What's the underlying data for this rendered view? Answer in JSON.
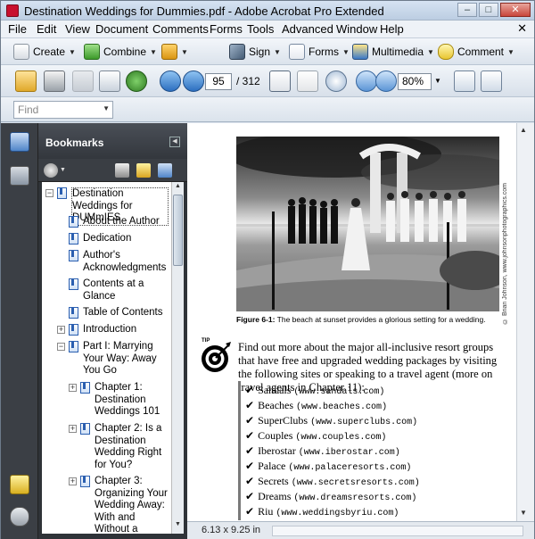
{
  "window": {
    "title": "Destination Weddings for Dummies.pdf - Adobe Acrobat Pro Extended",
    "min_label": "–",
    "max_label": "□",
    "close_label": "✕"
  },
  "menu": {
    "items": [
      "File",
      "Edit",
      "View",
      "Document",
      "Comments",
      "Forms",
      "Tools",
      "Advanced",
      "Window",
      "Help"
    ],
    "close_doc": "✕"
  },
  "toolbar1": {
    "create": "Create",
    "combine": "Combine",
    "sign": "Sign",
    "forms": "Forms",
    "multimedia": "Multimedia",
    "comment": "Comment"
  },
  "toolbar2": {
    "page_number": "95",
    "page_total": "/ 312",
    "zoom": "80%"
  },
  "find": {
    "placeholder": "Find"
  },
  "bookmarks": {
    "title": "Bookmarks",
    "items": [
      {
        "label": "Destination Weddings for DUMmIES",
        "expander": "−",
        "level": 0
      },
      {
        "label": "About the Author",
        "expander": "",
        "level": 1
      },
      {
        "label": "Dedication",
        "expander": "",
        "level": 1
      },
      {
        "label": "Author's Acknowledgments",
        "expander": "",
        "level": 1
      },
      {
        "label": "Contents at a Glance",
        "expander": "",
        "level": 1
      },
      {
        "label": "Table of Contents",
        "expander": "",
        "level": 1
      },
      {
        "label": "Introduction",
        "expander": "+",
        "level": 1
      },
      {
        "label": "Part I: Marrying Your Way: Away You Go",
        "expander": "−",
        "level": 1
      },
      {
        "label": "Chapter 1: Destination Weddings 101",
        "expander": "+",
        "level": 2
      },
      {
        "label": "Chapter 2: Is a Destination Wedding Right for You?",
        "expander": "+",
        "level": 2
      },
      {
        "label": "Chapter 3: Organizing Your Wedding Away: With and Without a",
        "expander": "+",
        "level": 2
      }
    ]
  },
  "document": {
    "photo_credit": "© Brian Johnson, www.johnsonphotographics.com",
    "caption_label": "Figure 6-1:",
    "caption_text": "The beach at sunset provides a glorious setting for a wedding.",
    "tip_label": "TIP",
    "paragraph": "Find out more about the major all-inclusive resort groups that have free and upgraded wedding packages by visiting the following sites or speaking to a travel agent (more on travel agents in Chapter 11):",
    "resorts": [
      {
        "name": "Sandals",
        "url": "(www.sandals.com)"
      },
      {
        "name": "Beaches",
        "url": "(www.beaches.com)"
      },
      {
        "name": "SuperClubs",
        "url": "(www.superclubs.com)"
      },
      {
        "name": "Couples",
        "url": "(www.couples.com)"
      },
      {
        "name": "Iberostar",
        "url": "(www.iberostar.com)"
      },
      {
        "name": "Palace",
        "url": "(www.palaceresorts.com)"
      },
      {
        "name": "Secrets",
        "url": "(www.secretsresorts.com)"
      },
      {
        "name": "Dreams",
        "url": "(www.dreamsresorts.com)"
      },
      {
        "name": "Riu",
        "url": "(www.weddingsbyriu.com)"
      }
    ]
  },
  "status": {
    "page_size": "6.13 x 9.25 in"
  }
}
